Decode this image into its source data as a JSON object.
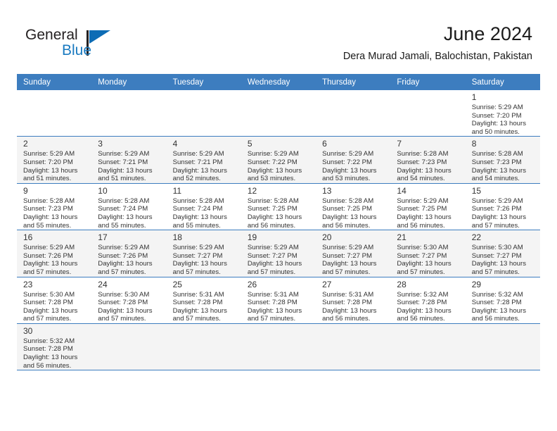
{
  "brand": {
    "line1": "General",
    "line2": "Blue",
    "triangle_color": "#0d6cb5",
    "text_color": "#231f20"
  },
  "header": {
    "title": "June 2024",
    "subtitle": "Dera Murad Jamali, Balochistan, Pakistan"
  },
  "theme": {
    "header_bg": "#3d7dbf",
    "header_text": "#ffffff",
    "row_shaded_bg": "#f4f4f4",
    "row_plain_bg": "#ffffff",
    "grid_line": "#3d7dbf",
    "text": "#333333"
  },
  "weekdays": [
    "Sunday",
    "Monday",
    "Tuesday",
    "Wednesday",
    "Thursday",
    "Friday",
    "Saturday"
  ],
  "weeks": [
    [
      {
        "day": "",
        "sunrise": "",
        "sunset": "",
        "daylight_line1": "",
        "daylight_line2": ""
      },
      {
        "day": "",
        "sunrise": "",
        "sunset": "",
        "daylight_line1": "",
        "daylight_line2": ""
      },
      {
        "day": "",
        "sunrise": "",
        "sunset": "",
        "daylight_line1": "",
        "daylight_line2": ""
      },
      {
        "day": "",
        "sunrise": "",
        "sunset": "",
        "daylight_line1": "",
        "daylight_line2": ""
      },
      {
        "day": "",
        "sunrise": "",
        "sunset": "",
        "daylight_line1": "",
        "daylight_line2": ""
      },
      {
        "day": "",
        "sunrise": "",
        "sunset": "",
        "daylight_line1": "",
        "daylight_line2": ""
      },
      {
        "day": "1",
        "sunrise": "Sunrise: 5:29 AM",
        "sunset": "Sunset: 7:20 PM",
        "daylight_line1": "Daylight: 13 hours",
        "daylight_line2": "and 50 minutes."
      }
    ],
    [
      {
        "day": "2",
        "sunrise": "Sunrise: 5:29 AM",
        "sunset": "Sunset: 7:20 PM",
        "daylight_line1": "Daylight: 13 hours",
        "daylight_line2": "and 51 minutes."
      },
      {
        "day": "3",
        "sunrise": "Sunrise: 5:29 AM",
        "sunset": "Sunset: 7:21 PM",
        "daylight_line1": "Daylight: 13 hours",
        "daylight_line2": "and 51 minutes."
      },
      {
        "day": "4",
        "sunrise": "Sunrise: 5:29 AM",
        "sunset": "Sunset: 7:21 PM",
        "daylight_line1": "Daylight: 13 hours",
        "daylight_line2": "and 52 minutes."
      },
      {
        "day": "5",
        "sunrise": "Sunrise: 5:29 AM",
        "sunset": "Sunset: 7:22 PM",
        "daylight_line1": "Daylight: 13 hours",
        "daylight_line2": "and 53 minutes."
      },
      {
        "day": "6",
        "sunrise": "Sunrise: 5:29 AM",
        "sunset": "Sunset: 7:22 PM",
        "daylight_line1": "Daylight: 13 hours",
        "daylight_line2": "and 53 minutes."
      },
      {
        "day": "7",
        "sunrise": "Sunrise: 5:28 AM",
        "sunset": "Sunset: 7:23 PM",
        "daylight_line1": "Daylight: 13 hours",
        "daylight_line2": "and 54 minutes."
      },
      {
        "day": "8",
        "sunrise": "Sunrise: 5:28 AM",
        "sunset": "Sunset: 7:23 PM",
        "daylight_line1": "Daylight: 13 hours",
        "daylight_line2": "and 54 minutes."
      }
    ],
    [
      {
        "day": "9",
        "sunrise": "Sunrise: 5:28 AM",
        "sunset": "Sunset: 7:23 PM",
        "daylight_line1": "Daylight: 13 hours",
        "daylight_line2": "and 55 minutes."
      },
      {
        "day": "10",
        "sunrise": "Sunrise: 5:28 AM",
        "sunset": "Sunset: 7:24 PM",
        "daylight_line1": "Daylight: 13 hours",
        "daylight_line2": "and 55 minutes."
      },
      {
        "day": "11",
        "sunrise": "Sunrise: 5:28 AM",
        "sunset": "Sunset: 7:24 PM",
        "daylight_line1": "Daylight: 13 hours",
        "daylight_line2": "and 55 minutes."
      },
      {
        "day": "12",
        "sunrise": "Sunrise: 5:28 AM",
        "sunset": "Sunset: 7:25 PM",
        "daylight_line1": "Daylight: 13 hours",
        "daylight_line2": "and 56 minutes."
      },
      {
        "day": "13",
        "sunrise": "Sunrise: 5:28 AM",
        "sunset": "Sunset: 7:25 PM",
        "daylight_line1": "Daylight: 13 hours",
        "daylight_line2": "and 56 minutes."
      },
      {
        "day": "14",
        "sunrise": "Sunrise: 5:29 AM",
        "sunset": "Sunset: 7:25 PM",
        "daylight_line1": "Daylight: 13 hours",
        "daylight_line2": "and 56 minutes."
      },
      {
        "day": "15",
        "sunrise": "Sunrise: 5:29 AM",
        "sunset": "Sunset: 7:26 PM",
        "daylight_line1": "Daylight: 13 hours",
        "daylight_line2": "and 57 minutes."
      }
    ],
    [
      {
        "day": "16",
        "sunrise": "Sunrise: 5:29 AM",
        "sunset": "Sunset: 7:26 PM",
        "daylight_line1": "Daylight: 13 hours",
        "daylight_line2": "and 57 minutes."
      },
      {
        "day": "17",
        "sunrise": "Sunrise: 5:29 AM",
        "sunset": "Sunset: 7:26 PM",
        "daylight_line1": "Daylight: 13 hours",
        "daylight_line2": "and 57 minutes."
      },
      {
        "day": "18",
        "sunrise": "Sunrise: 5:29 AM",
        "sunset": "Sunset: 7:27 PM",
        "daylight_line1": "Daylight: 13 hours",
        "daylight_line2": "and 57 minutes."
      },
      {
        "day": "19",
        "sunrise": "Sunrise: 5:29 AM",
        "sunset": "Sunset: 7:27 PM",
        "daylight_line1": "Daylight: 13 hours",
        "daylight_line2": "and 57 minutes."
      },
      {
        "day": "20",
        "sunrise": "Sunrise: 5:29 AM",
        "sunset": "Sunset: 7:27 PM",
        "daylight_line1": "Daylight: 13 hours",
        "daylight_line2": "and 57 minutes."
      },
      {
        "day": "21",
        "sunrise": "Sunrise: 5:30 AM",
        "sunset": "Sunset: 7:27 PM",
        "daylight_line1": "Daylight: 13 hours",
        "daylight_line2": "and 57 minutes."
      },
      {
        "day": "22",
        "sunrise": "Sunrise: 5:30 AM",
        "sunset": "Sunset: 7:27 PM",
        "daylight_line1": "Daylight: 13 hours",
        "daylight_line2": "and 57 minutes."
      }
    ],
    [
      {
        "day": "23",
        "sunrise": "Sunrise: 5:30 AM",
        "sunset": "Sunset: 7:28 PM",
        "daylight_line1": "Daylight: 13 hours",
        "daylight_line2": "and 57 minutes."
      },
      {
        "day": "24",
        "sunrise": "Sunrise: 5:30 AM",
        "sunset": "Sunset: 7:28 PM",
        "daylight_line1": "Daylight: 13 hours",
        "daylight_line2": "and 57 minutes."
      },
      {
        "day": "25",
        "sunrise": "Sunrise: 5:31 AM",
        "sunset": "Sunset: 7:28 PM",
        "daylight_line1": "Daylight: 13 hours",
        "daylight_line2": "and 57 minutes."
      },
      {
        "day": "26",
        "sunrise": "Sunrise: 5:31 AM",
        "sunset": "Sunset: 7:28 PM",
        "daylight_line1": "Daylight: 13 hours",
        "daylight_line2": "and 57 minutes."
      },
      {
        "day": "27",
        "sunrise": "Sunrise: 5:31 AM",
        "sunset": "Sunset: 7:28 PM",
        "daylight_line1": "Daylight: 13 hours",
        "daylight_line2": "and 56 minutes."
      },
      {
        "day": "28",
        "sunrise": "Sunrise: 5:32 AM",
        "sunset": "Sunset: 7:28 PM",
        "daylight_line1": "Daylight: 13 hours",
        "daylight_line2": "and 56 minutes."
      },
      {
        "day": "29",
        "sunrise": "Sunrise: 5:32 AM",
        "sunset": "Sunset: 7:28 PM",
        "daylight_line1": "Daylight: 13 hours",
        "daylight_line2": "and 56 minutes."
      }
    ],
    [
      {
        "day": "30",
        "sunrise": "Sunrise: 5:32 AM",
        "sunset": "Sunset: 7:28 PM",
        "daylight_line1": "Daylight: 13 hours",
        "daylight_line2": "and 56 minutes."
      },
      {
        "day": "",
        "sunrise": "",
        "sunset": "",
        "daylight_line1": "",
        "daylight_line2": ""
      },
      {
        "day": "",
        "sunrise": "",
        "sunset": "",
        "daylight_line1": "",
        "daylight_line2": ""
      },
      {
        "day": "",
        "sunrise": "",
        "sunset": "",
        "daylight_line1": "",
        "daylight_line2": ""
      },
      {
        "day": "",
        "sunrise": "",
        "sunset": "",
        "daylight_line1": "",
        "daylight_line2": ""
      },
      {
        "day": "",
        "sunrise": "",
        "sunset": "",
        "daylight_line1": "",
        "daylight_line2": ""
      },
      {
        "day": "",
        "sunrise": "",
        "sunset": "",
        "daylight_line1": "",
        "daylight_line2": ""
      }
    ]
  ]
}
